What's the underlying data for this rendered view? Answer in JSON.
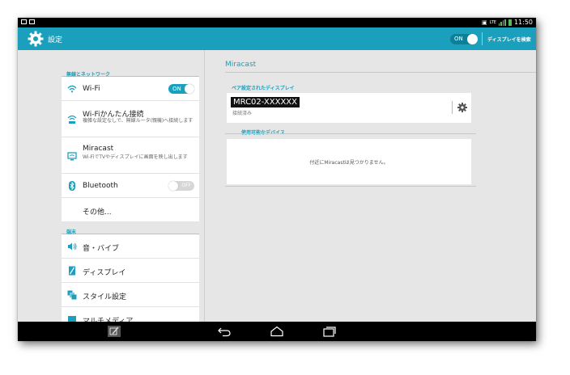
{
  "status_bar": {
    "time": "11:50",
    "network": "LTE"
  },
  "action_bar": {
    "title": "設定",
    "toggle_label": "ON",
    "search_displays": "ディスプレイを検索"
  },
  "left": {
    "section_wireless": "無線とネットワーク",
    "items": [
      {
        "title": "Wi-Fi",
        "toggle": "ON"
      },
      {
        "title": "Wi-Fiかんたん接続",
        "subtitle": "複雑な設定なしで、無線ルータ(親機)へ接続します"
      },
      {
        "title": "Miracast",
        "subtitle": "Wi-FiでTVやディスプレイに画面を映し出します"
      },
      {
        "title": "Bluetooth",
        "toggle": "OFF"
      },
      {
        "title": "その他..."
      }
    ],
    "section_device": "端末",
    "device_items": [
      {
        "title": "音・バイブ"
      },
      {
        "title": "ディスプレイ"
      },
      {
        "title": "スタイル設定"
      },
      {
        "title": "マルチメディア"
      }
    ]
  },
  "right": {
    "title": "Miracast",
    "paired_header": "ペア設定されたディスプレイ",
    "device": {
      "name": "MRC02-XXXXXX",
      "status": "接続済み"
    },
    "available_header": "使用可能なデバイス",
    "empty_message": "付近にMiracastは見つかりません。"
  },
  "colors": {
    "accent": "#1aa0bd",
    "background": "#e6e6e6"
  }
}
